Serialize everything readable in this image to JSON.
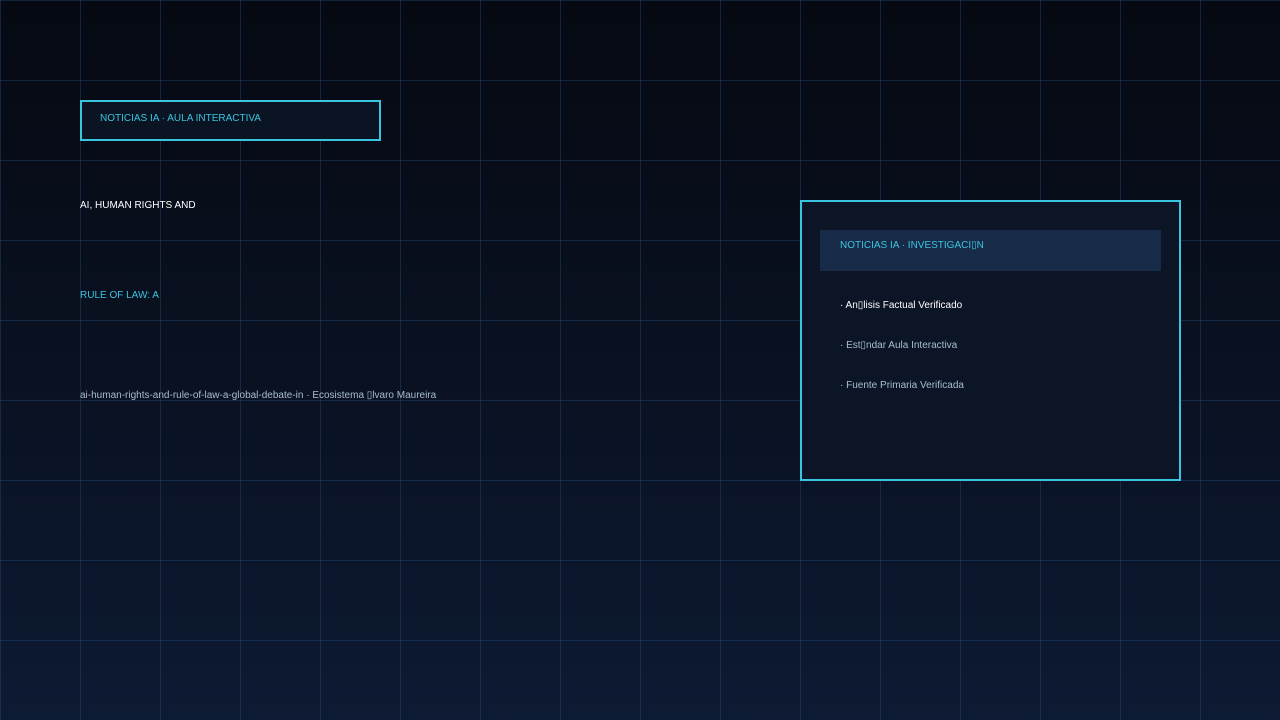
{
  "badge": {
    "label": "NOTICIAS IA · AULA INTERACTIVA"
  },
  "headline": {
    "line1": "AI, HUMAN RIGHTS AND",
    "line2": "RULE OF LAW: A"
  },
  "meta": {
    "slug_line": "ai-human-rights-and-rule-of-law-a-global-debate-in · Ecosistema ▯lvaro Maureira"
  },
  "panel": {
    "header": "NOTICIAS IA · INVESTIGACI▯N",
    "items": [
      "· An▯lisis Factual Verificado",
      "· Est▯ndar Aula Interactiva",
      "· Fuente Primaria Verificada"
    ]
  },
  "colors": {
    "accent": "#3bc4e0",
    "background_top": "#060912",
    "background_bottom": "#0d1a33",
    "header_fill": "#172a48",
    "muted_text": "#a9bdd2"
  }
}
